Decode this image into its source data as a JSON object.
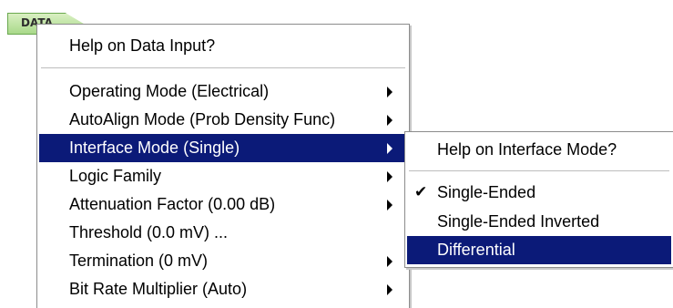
{
  "tab": {
    "label": "DATA"
  },
  "main_menu": {
    "help": "Help on Data Input?",
    "items": [
      {
        "label": "Operating Mode (Electrical)"
      },
      {
        "label": "AutoAlign Mode (Prob Density Func)"
      },
      {
        "label": "Interface Mode (Single)"
      },
      {
        "label": "Logic Family"
      },
      {
        "label": "Attenuation Factor (0.00 dB)"
      },
      {
        "label": "Threshold (0.0 mV) ..."
      },
      {
        "label": "Termination (0 mV)"
      },
      {
        "label": "Bit Rate Multiplier (Auto)"
      }
    ]
  },
  "sub_menu": {
    "help": "Help on Interface Mode?",
    "items": [
      {
        "label": "Single-Ended",
        "checked": true
      },
      {
        "label": "Single-Ended Inverted"
      },
      {
        "label": "Differential"
      }
    ],
    "check_glyph": "✔"
  },
  "colors": {
    "highlight": "#0b1a78",
    "tab_green": "#a9d98a"
  }
}
